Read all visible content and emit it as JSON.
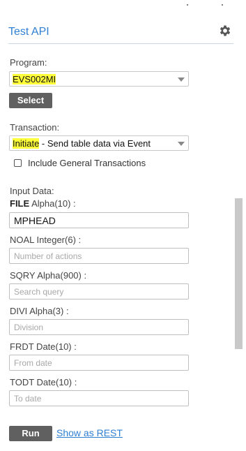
{
  "header": {
    "title": "Test API",
    "settings_icon": "gear-icon"
  },
  "program": {
    "label": "Program:",
    "value": "EVS002MI",
    "select_button": "Select"
  },
  "transaction": {
    "label": "Transaction:",
    "value_highlight": "Initiate",
    "value_rest": " - Send table data via Event"
  },
  "include_general": {
    "label": "Include General Transactions",
    "checked": false
  },
  "input_data": {
    "label": "Input Data:",
    "fields": [
      {
        "name": "FILE",
        "type": " Alpha(10) :",
        "value": "MPHEAD",
        "placeholder": ""
      },
      {
        "name": "NOAL",
        "type": " Integer(6) :",
        "value": "",
        "placeholder": "Number of actions"
      },
      {
        "name": "SQRY",
        "type": " Alpha(900) :",
        "value": "",
        "placeholder": "Search query"
      },
      {
        "name": "DIVI",
        "type": " Alpha(3) :",
        "value": "",
        "placeholder": "Division"
      },
      {
        "name": "FRDT",
        "type": " Date(10) :",
        "value": "",
        "placeholder": "From date"
      },
      {
        "name": "TODT",
        "type": " Date(10) :",
        "value": "",
        "placeholder": "To date"
      }
    ]
  },
  "actions": {
    "run": "Run",
    "show_rest": "Show as REST"
  }
}
